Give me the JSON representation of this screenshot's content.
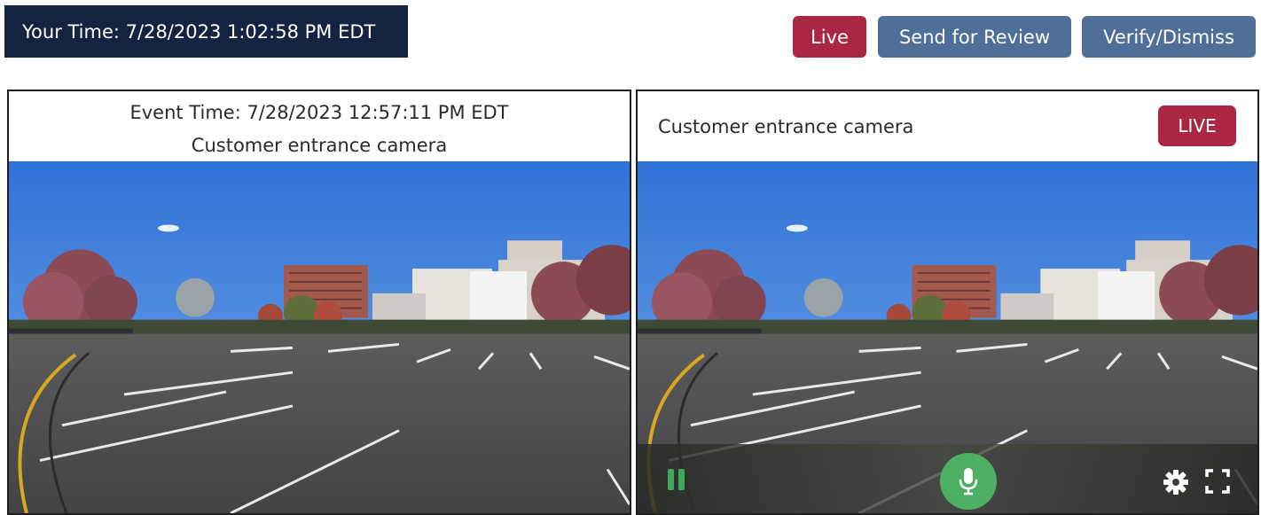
{
  "header": {
    "your_time_label": "Your Time: 7/28/2023 1:02:58 PM EDT"
  },
  "toolbar": {
    "live_label": "Live",
    "send_review_label": "Send for Review",
    "verify_dismiss_label": "Verify/Dismiss"
  },
  "event_panel": {
    "event_time_label": "Event Time: 7/28/2023 12:57:11 PM EDT",
    "camera_name": "Customer entrance camera"
  },
  "live_panel": {
    "camera_name": "Customer entrance camera",
    "live_badge": "LIVE",
    "controls": {
      "pause_icon": "pause-icon",
      "mic_icon": "microphone-icon",
      "settings_icon": "gear-icon",
      "fullscreen_icon": "fullscreen-icon"
    }
  },
  "colors": {
    "header_bg": "#14233f",
    "live_red": "#a92742",
    "action_blue": "#4f6f98",
    "mic_green": "#4caf61"
  }
}
